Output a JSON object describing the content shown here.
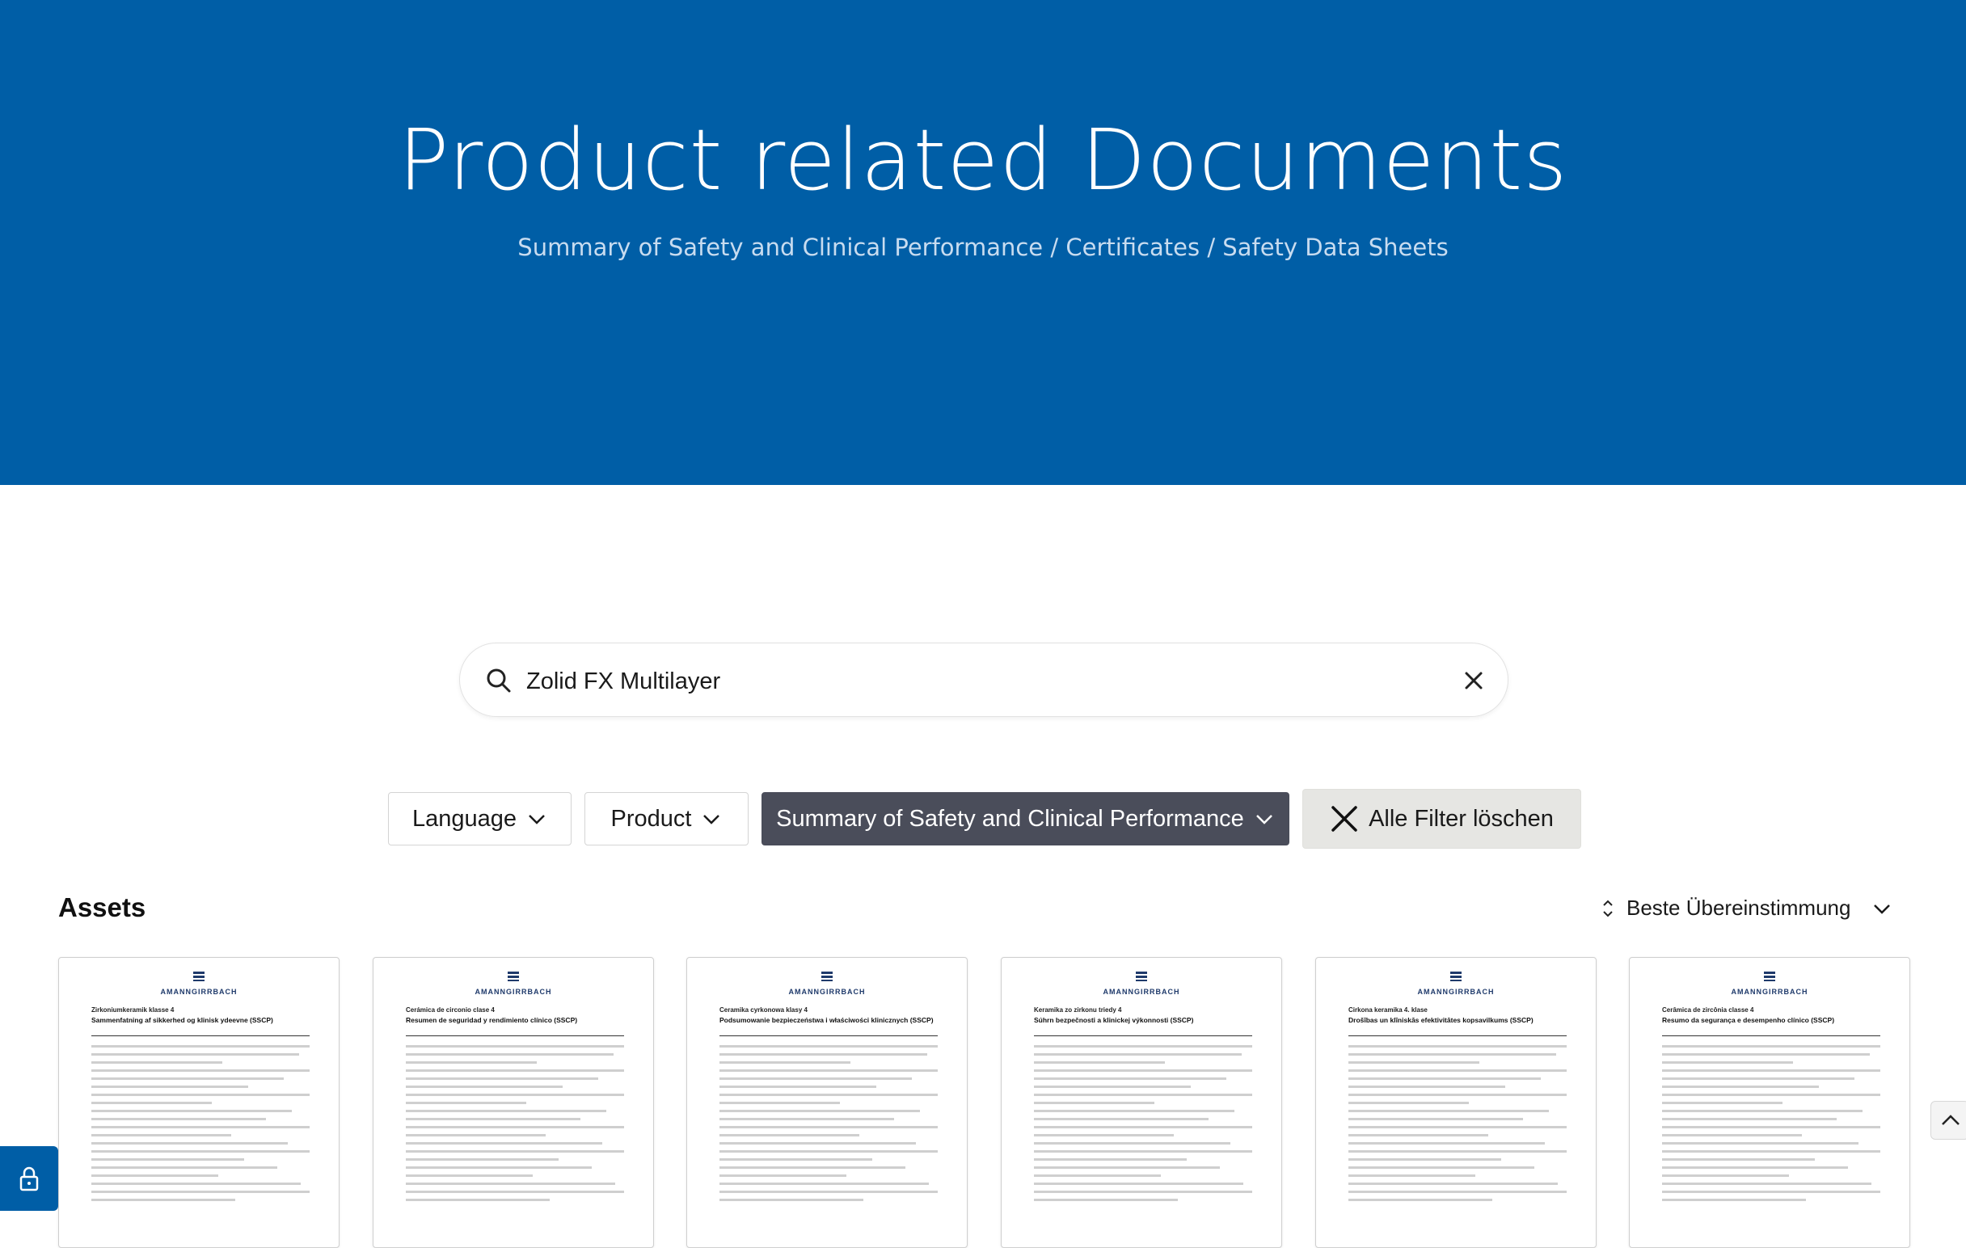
{
  "hero": {
    "title": "Product related Documents",
    "subtitle": "Summary of Safety and Clinical Performance / Certificates / Safety Data Sheets",
    "background_color": "#005ea6"
  },
  "search": {
    "value": "Zolid FX Multilayer",
    "search_icon": "search-icon",
    "clear_icon": "close-icon"
  },
  "filters": {
    "language_label": "Language",
    "product_label": "Product",
    "doc_type_label": "Summary of Safety and Clinical Performance",
    "clear_all_label": "Alle Filter löschen",
    "active_color": "#4a4d5a"
  },
  "assets": {
    "title": "Assets",
    "sort_label": "Beste Übereinstimmung",
    "cards": [
      {
        "logo": "AMANNGIRRBACH",
        "doc_title": "Zirkoniumkeramik klasse 4",
        "doc_subtitle": "Sammenfatning af sikkerhed og klinisk ydeevne (SSCP)"
      },
      {
        "logo": "AMANNGIRRBACH",
        "doc_title": "Cerámica de circonio clase 4",
        "doc_subtitle": "Resumen de seguridad y rendimiento clínico (SSCP)"
      },
      {
        "logo": "AMANNGIRRBACH",
        "doc_title": "Ceramika cyrkonowa klasy 4",
        "doc_subtitle": "Podsumowanie bezpieczeństwa i właściwości klinicznych (SSCP)"
      },
      {
        "logo": "AMANNGIRRBACH",
        "doc_title": "Keramika zo zirkonu triedy 4",
        "doc_subtitle": "Súhrn bezpečnosti a klinickej výkonnosti (SSCP)"
      },
      {
        "logo": "AMANNGIRRBACH",
        "doc_title": "Cirkona keramika 4. klase",
        "doc_subtitle": "Drošības un klīniskās efektivitātes kopsavilkums (SSCP)"
      },
      {
        "logo": "AMANNGIRRBACH",
        "doc_title": "Cerâmica de zircônia classe 4",
        "doc_subtitle": "Resumo da segurança e desempenho clínico (SSCP)"
      }
    ]
  },
  "widgets": {
    "lock_icon": "lock-icon",
    "scroll_top_icon": "chevron-up-icon"
  }
}
